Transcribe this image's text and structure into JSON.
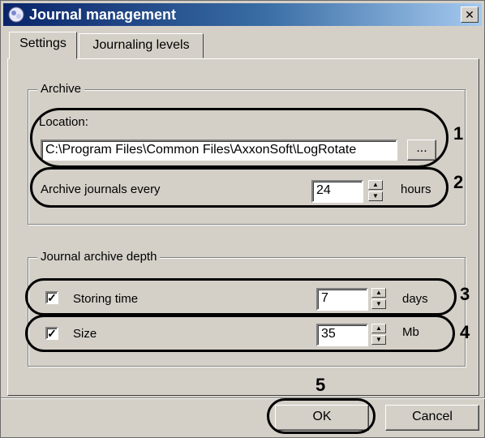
{
  "window": {
    "title": "Journal management",
    "close_symbol": "✕"
  },
  "tabs": [
    {
      "label": "Settings"
    },
    {
      "label": "Journaling levels"
    }
  ],
  "archive": {
    "legend": "Archive",
    "location_label": "Location:",
    "location_value": "C:\\Program Files\\Common Files\\AxxonSoft\\LogRotate",
    "browse_label": "...",
    "every_label": "Archive journals every",
    "every_value": "24",
    "every_unit": "hours"
  },
  "depth": {
    "legend": "Journal archive depth",
    "storing": {
      "label": "Storing time",
      "checked": true,
      "value": "7",
      "unit": "days"
    },
    "size": {
      "label": "Size",
      "checked": true,
      "value": "35",
      "unit": "Mb"
    }
  },
  "buttons": {
    "ok": "OK",
    "cancel": "Cancel"
  },
  "callouts": [
    "1",
    "2",
    "3",
    "4",
    "5"
  ],
  "check_mark": "✓",
  "spin_up": "▲",
  "spin_down": "▼"
}
